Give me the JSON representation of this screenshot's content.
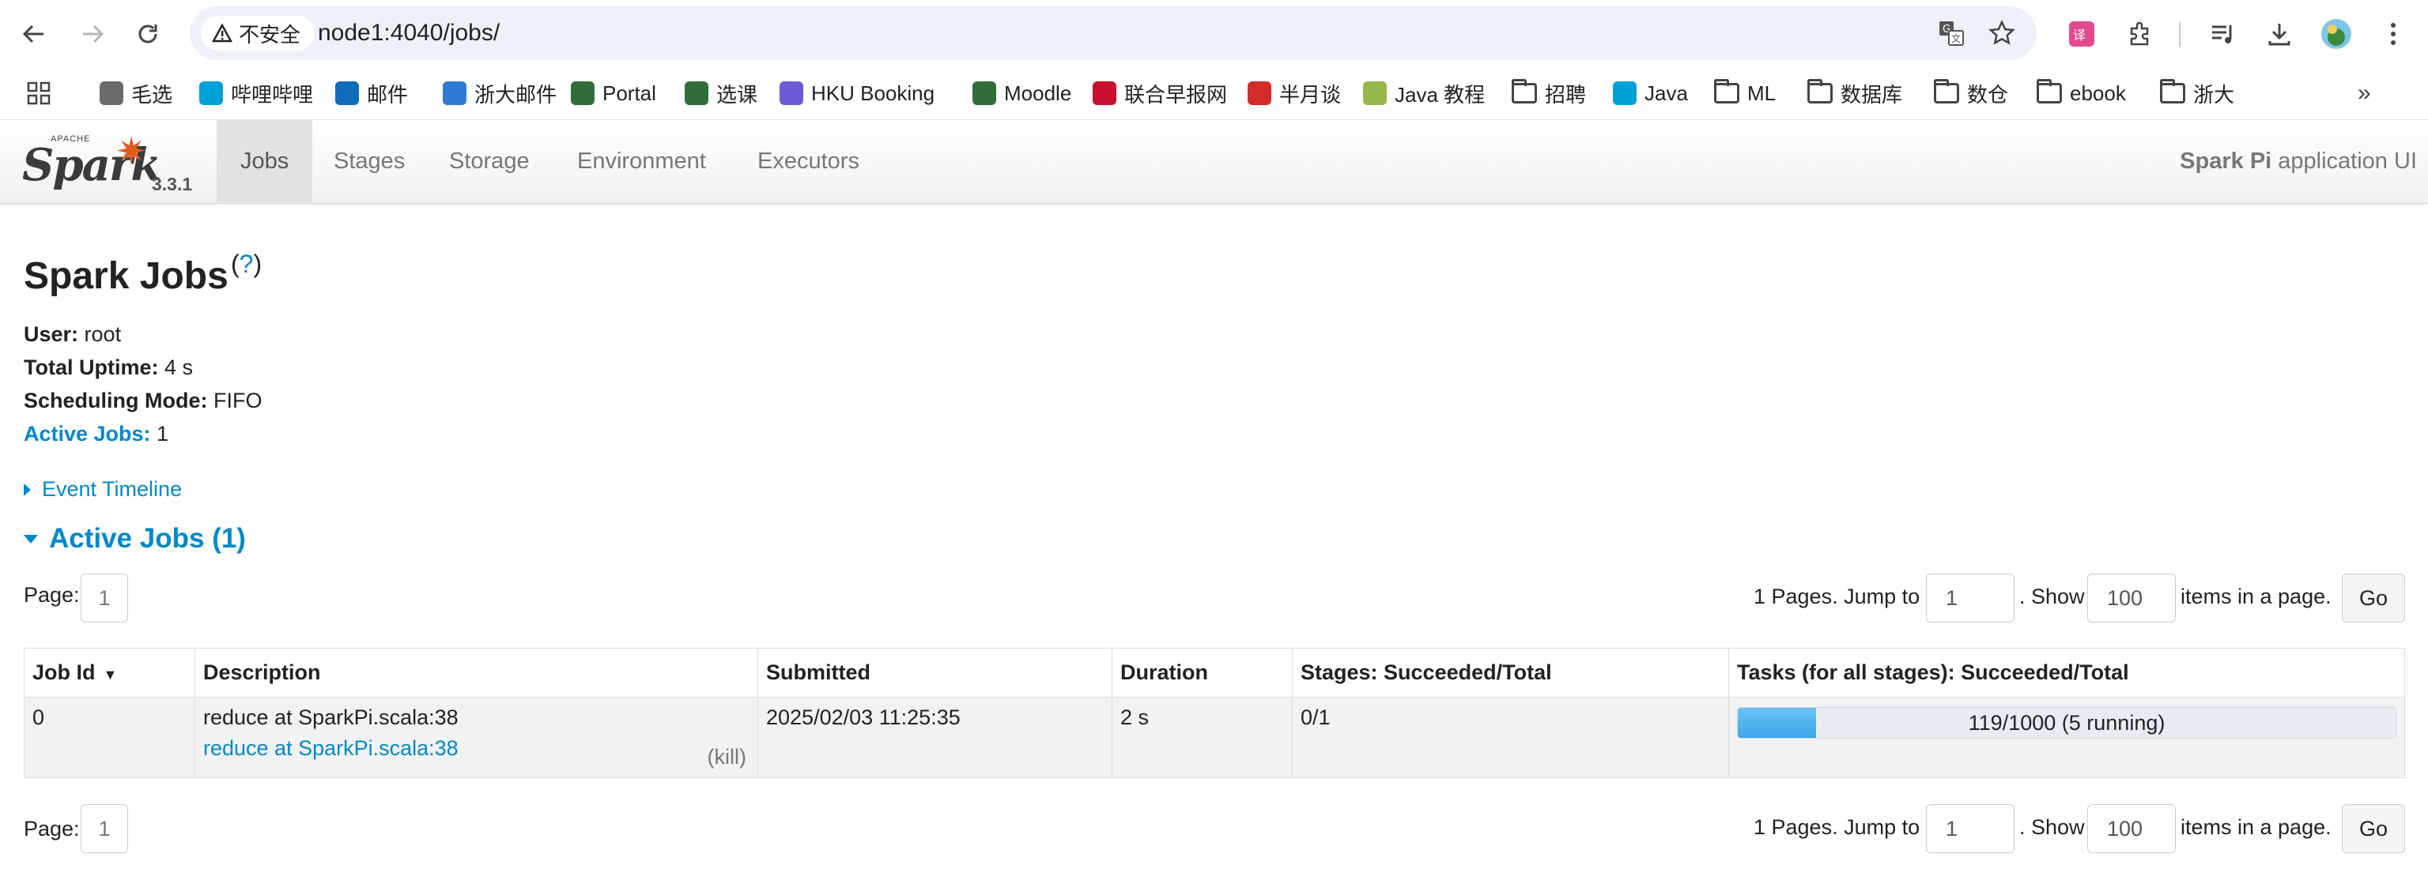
{
  "browser": {
    "security_label": "不安全",
    "url": "node1:4040/jobs/",
    "bookmarks": [
      {
        "label": "毛选",
        "icon": "photo-icon",
        "color": "#6b6b6b"
      },
      {
        "label": "哔哩哔哩",
        "icon": "bilibili-icon",
        "color": "#00a1d6"
      },
      {
        "label": "邮件",
        "icon": "outlook-icon",
        "color": "#0f6cbd"
      },
      {
        "label": "浙大邮件",
        "icon": "mail-icon",
        "color": "#2e7bd6"
      },
      {
        "label": "Portal",
        "icon": "university-crest-icon",
        "color": "#2f6e3a"
      },
      {
        "label": "选课",
        "icon": "university-crest-icon",
        "color": "#2f6e3a"
      },
      {
        "label": "HKU Booking",
        "icon": "booking-icon",
        "color": "#6b5bd6"
      },
      {
        "label": "Moodle",
        "icon": "university-crest-icon",
        "color": "#2f6e3a"
      },
      {
        "label": "联合早报网",
        "icon": "zaobao-icon",
        "color": "#c8102e"
      },
      {
        "label": "半月谈",
        "icon": "banyuetan-icon",
        "color": "#d42b2b"
      },
      {
        "label": "Java 教程",
        "icon": "runoob-icon",
        "color": "#96b94a"
      },
      {
        "label": "招聘",
        "icon": "folder-icon",
        "color": "#444444"
      },
      {
        "label": "Java",
        "icon": "bilibili-icon",
        "color": "#00a1d6"
      },
      {
        "label": "ML",
        "icon": "folder-icon",
        "color": "#444444"
      },
      {
        "label": "数据库",
        "icon": "folder-icon",
        "color": "#444444"
      },
      {
        "label": "数仓",
        "icon": "folder-icon",
        "color": "#444444"
      },
      {
        "label": "ebook",
        "icon": "folder-icon",
        "color": "#444444"
      },
      {
        "label": "浙大",
        "icon": "folder-icon",
        "color": "#444444"
      }
    ]
  },
  "spark": {
    "logo_apache": "APACHE",
    "logo_text": "Spark",
    "version": "3.3.1",
    "tabs": [
      "Jobs",
      "Stages",
      "Storage",
      "Environment",
      "Executors"
    ],
    "active_tab": "Jobs",
    "app_name": "Spark Pi",
    "app_suffix": "application UI"
  },
  "page": {
    "title": "Spark Jobs",
    "help": "?",
    "user_label": "User:",
    "user": "root",
    "uptime_label": "Total Uptime:",
    "uptime": "4 s",
    "mode_label": "Scheduling Mode:",
    "mode": "FIFO",
    "active_jobs_label": "Active Jobs:",
    "active_jobs": "1",
    "event_timeline": "Event Timeline",
    "active_section": "Active Jobs (1)"
  },
  "pager": {
    "page_label": "Page:",
    "page": "1",
    "pages_text": "1 Pages. Jump to",
    "jump_value": "1",
    "show_text": ". Show",
    "show_value": "100",
    "items_text": "items in a page.",
    "go": "Go"
  },
  "table": {
    "headers": [
      "Job Id",
      "Description",
      "Submitted",
      "Duration",
      "Stages: Succeeded/Total",
      "Tasks (for all stages): Succeeded/Total"
    ],
    "sort_indicator": "▼",
    "rows": [
      {
        "job_id": "0",
        "description": "reduce at SparkPi.scala:38",
        "description_link": "reduce at SparkPi.scala:38",
        "kill": "(kill)",
        "submitted": "2025/02/03 11:25:35",
        "duration": "2 s",
        "stages": "0/1",
        "tasks_label": "119/1000 (5 running)",
        "tasks_succeeded": 119,
        "tasks_total": 1000
      }
    ]
  },
  "colors": {
    "link": "#0088cc",
    "spark_orange": "#e25a1c",
    "progress_fill": "#3aa8ea"
  }
}
